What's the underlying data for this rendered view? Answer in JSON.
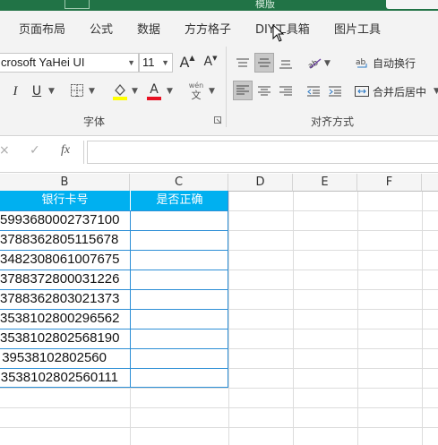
{
  "title_bar": {
    "document_title": "模版"
  },
  "tabs": [
    "页面布局",
    "公式",
    "数据",
    "方方格子",
    "DIY工具箱",
    "图片工具"
  ],
  "ribbon": {
    "font_name": "Microsoft YaHei UI",
    "font_name_visible": "crosoft YaHei UI",
    "font_size": "11",
    "increase_font_label": "A",
    "decrease_font_label": "A",
    "italic_label": "I",
    "underline_label": "U",
    "font_color_label": "A",
    "phonetic_label": "wén",
    "phonetic_sub": "文",
    "font_group_label": "字体",
    "wrap_text_label": "自动换行",
    "merge_center_label": "合并后居中",
    "alignment_group_label": "对齐方式"
  },
  "formula_bar": {
    "cancel": "×",
    "confirm": "✓",
    "fx": "fx",
    "value": ""
  },
  "columns": [
    "B",
    "C",
    "D",
    "E",
    "F"
  ],
  "table": {
    "header_b": "银行卡号",
    "header_c": "是否正确",
    "rows": [
      "5993680002737100",
      "3788362805115678",
      "3482308061007675",
      "3788372800031226",
      "3788362803021373",
      "3538102800296562",
      "3538102802568190",
      "39538102802560",
      "3538102802560111"
    ]
  },
  "colors": {
    "ribbon_green": "#217346",
    "header_fill": "#00b0f0",
    "font_color_red": "#e81123",
    "highlight_yellow": "#ffff00"
  }
}
